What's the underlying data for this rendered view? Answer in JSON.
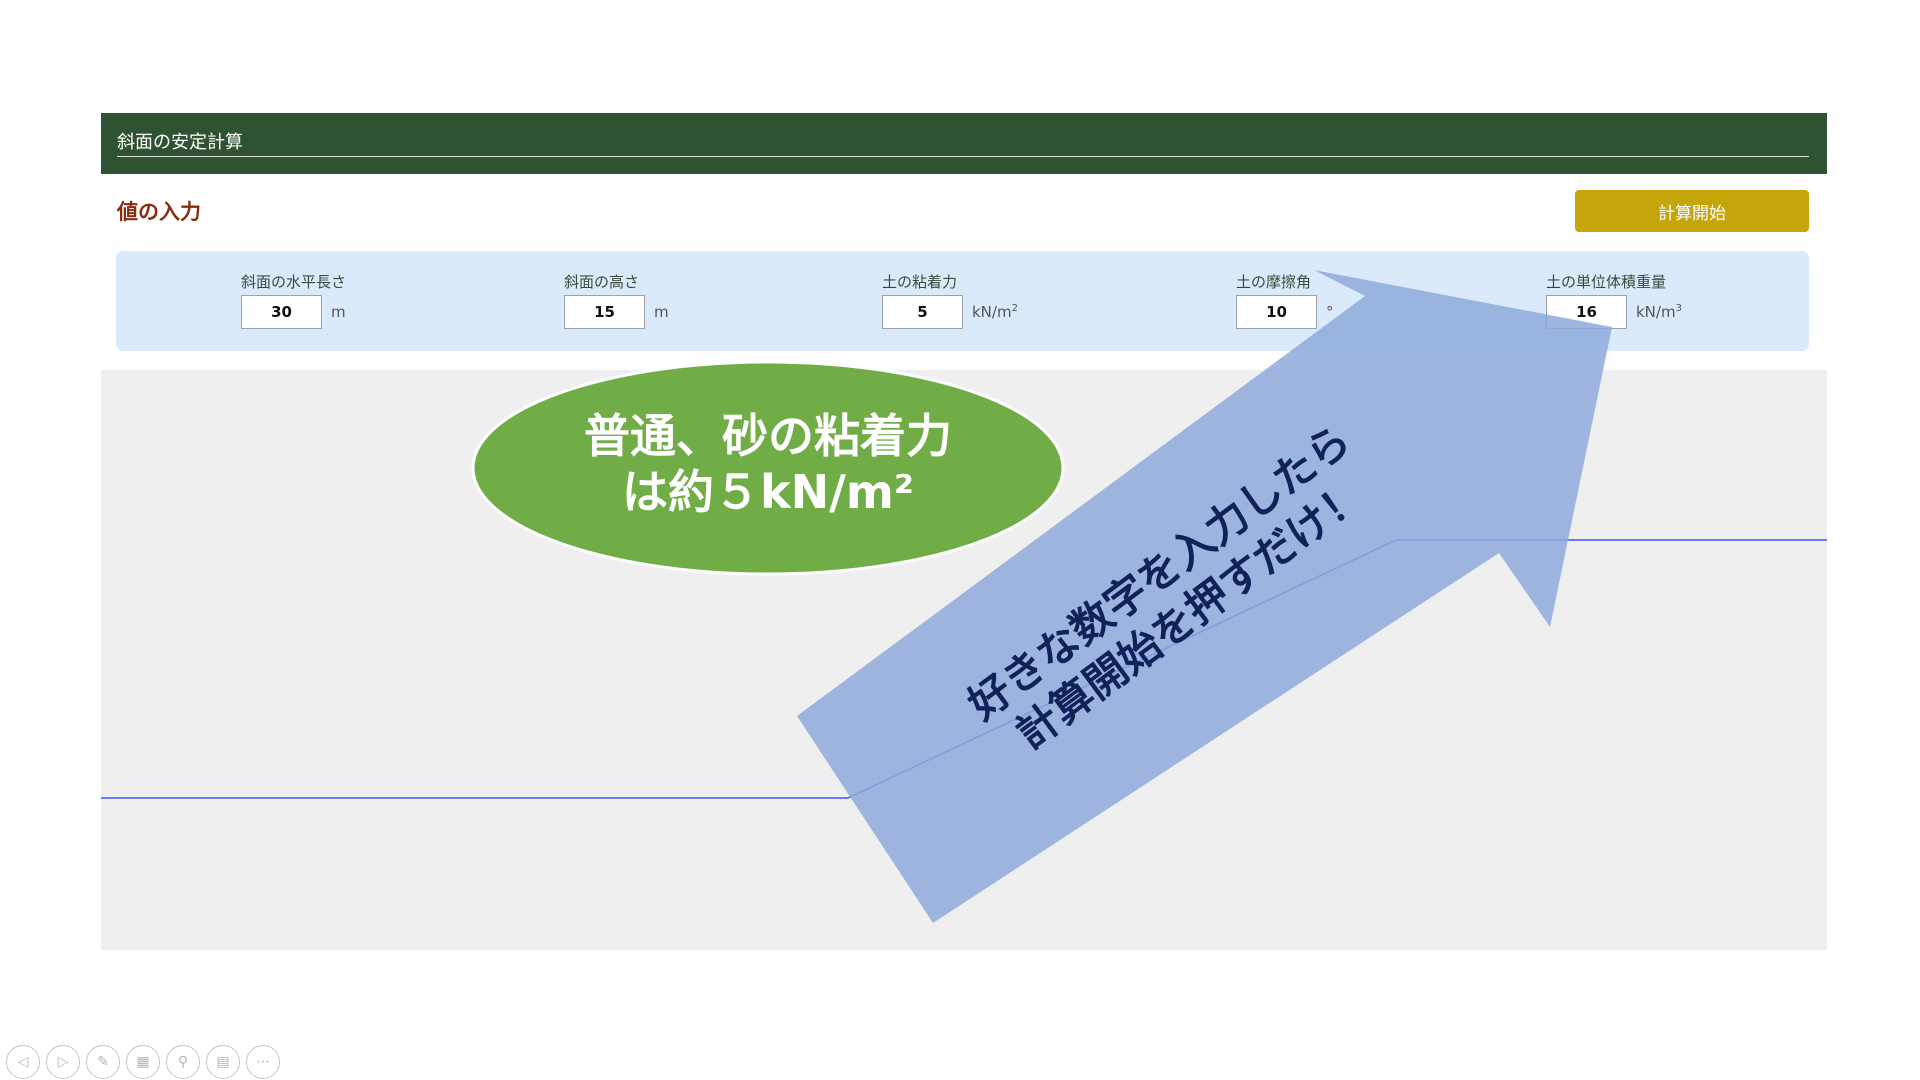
{
  "app": {
    "title": "斜面の安定計算"
  },
  "section": {
    "title": "値の入力",
    "start_button_label": "計算開始"
  },
  "inputs": [
    {
      "label": "斜面の水平長さ",
      "value": "30",
      "unit": "m",
      "unit_sup": ""
    },
    {
      "label": "斜面の高さ",
      "value": "15",
      "unit": "m",
      "unit_sup": ""
    },
    {
      "label": "土の粘着力",
      "value": "5",
      "unit": "kN/m",
      "unit_sup": "2"
    },
    {
      "label": "土の摩擦角",
      "value": "10",
      "unit": "°",
      "unit_sup": ""
    },
    {
      "label": "土の単位体積重量",
      "value": "16",
      "unit": "kN/m",
      "unit_sup": "3"
    }
  ],
  "callout_oval": {
    "line1": "普通、砂の粘着力",
    "line2": "は約５kN/m²",
    "color": "#70ad47"
  },
  "callout_arrow": {
    "line1": "好きな数字を入力したら",
    "line2": "計算開始を押すだけ！",
    "color": "#8eaadb",
    "text_color": "#10225a"
  },
  "slope": {
    "line_color": "#4455ee"
  },
  "presenter_toolbar": {
    "icons": [
      "previous-icon",
      "next-icon",
      "pen-icon",
      "slides-grid-icon",
      "zoom-icon",
      "subtitles-icon",
      "more-icon"
    ]
  }
}
